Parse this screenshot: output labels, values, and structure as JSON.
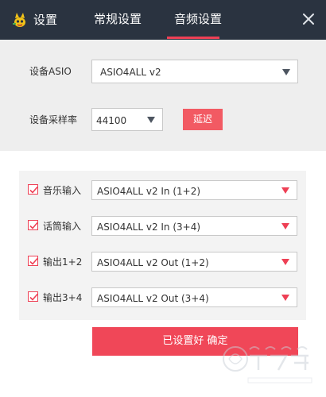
{
  "header": {
    "title": "设置",
    "tabs": [
      {
        "label": "常规设置",
        "active": false
      },
      {
        "label": "音频设置",
        "active": true
      }
    ],
    "accent_color": "#ee4055",
    "background_color": "#2a3340"
  },
  "asio": {
    "label": "设备ASIO",
    "selected": "ASIO4ALL v2"
  },
  "sample_rate": {
    "label": "设备采样率",
    "selected": "44100",
    "delay_button": "延迟"
  },
  "io": [
    {
      "label": "音乐输入",
      "checked": true,
      "selected": "ASIO4ALL v2 In (1+2)"
    },
    {
      "label": "话筒输入",
      "checked": true,
      "selected": "ASIO4ALL v2 In (3+4)"
    },
    {
      "label": "输出1+2",
      "checked": true,
      "selected": "ASIO4ALL v2 Out (1+2)"
    },
    {
      "label": "输出3+4",
      "checked": true,
      "selected": "ASIO4ALL v2 Out (3+4)"
    }
  ],
  "confirm_button": "已设置好 确定",
  "watermark": {
    "text": "野狼音频网",
    "subtext": "WWW.XX778.COM"
  }
}
